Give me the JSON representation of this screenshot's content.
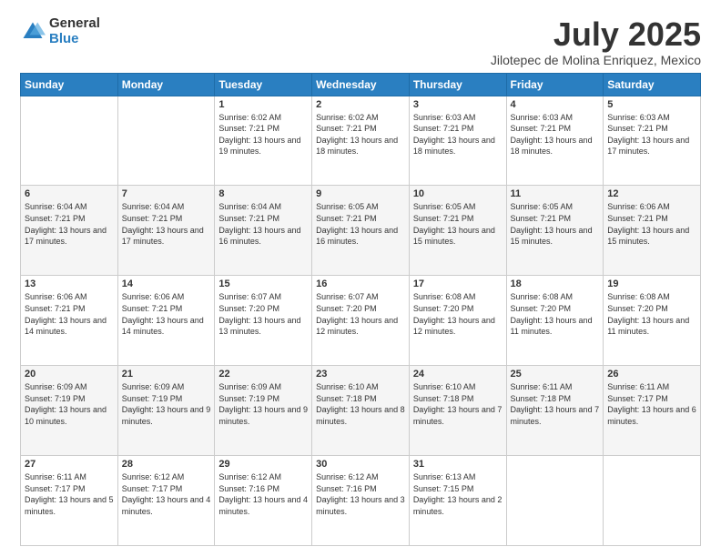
{
  "logo": {
    "general": "General",
    "blue": "Blue"
  },
  "title": {
    "month": "July 2025",
    "location": "Jilotepec de Molina Enriquez, Mexico"
  },
  "weekdays": [
    "Sunday",
    "Monday",
    "Tuesday",
    "Wednesday",
    "Thursday",
    "Friday",
    "Saturday"
  ],
  "weeks": [
    [
      {
        "day": "",
        "sunrise": "",
        "sunset": "",
        "daylight": ""
      },
      {
        "day": "",
        "sunrise": "",
        "sunset": "",
        "daylight": ""
      },
      {
        "day": "1",
        "sunrise": "Sunrise: 6:02 AM",
        "sunset": "Sunset: 7:21 PM",
        "daylight": "Daylight: 13 hours and 19 minutes."
      },
      {
        "day": "2",
        "sunrise": "Sunrise: 6:02 AM",
        "sunset": "Sunset: 7:21 PM",
        "daylight": "Daylight: 13 hours and 18 minutes."
      },
      {
        "day": "3",
        "sunrise": "Sunrise: 6:03 AM",
        "sunset": "Sunset: 7:21 PM",
        "daylight": "Daylight: 13 hours and 18 minutes."
      },
      {
        "day": "4",
        "sunrise": "Sunrise: 6:03 AM",
        "sunset": "Sunset: 7:21 PM",
        "daylight": "Daylight: 13 hours and 18 minutes."
      },
      {
        "day": "5",
        "sunrise": "Sunrise: 6:03 AM",
        "sunset": "Sunset: 7:21 PM",
        "daylight": "Daylight: 13 hours and 17 minutes."
      }
    ],
    [
      {
        "day": "6",
        "sunrise": "Sunrise: 6:04 AM",
        "sunset": "Sunset: 7:21 PM",
        "daylight": "Daylight: 13 hours and 17 minutes."
      },
      {
        "day": "7",
        "sunrise": "Sunrise: 6:04 AM",
        "sunset": "Sunset: 7:21 PM",
        "daylight": "Daylight: 13 hours and 17 minutes."
      },
      {
        "day": "8",
        "sunrise": "Sunrise: 6:04 AM",
        "sunset": "Sunset: 7:21 PM",
        "daylight": "Daylight: 13 hours and 16 minutes."
      },
      {
        "day": "9",
        "sunrise": "Sunrise: 6:05 AM",
        "sunset": "Sunset: 7:21 PM",
        "daylight": "Daylight: 13 hours and 16 minutes."
      },
      {
        "day": "10",
        "sunrise": "Sunrise: 6:05 AM",
        "sunset": "Sunset: 7:21 PM",
        "daylight": "Daylight: 13 hours and 15 minutes."
      },
      {
        "day": "11",
        "sunrise": "Sunrise: 6:05 AM",
        "sunset": "Sunset: 7:21 PM",
        "daylight": "Daylight: 13 hours and 15 minutes."
      },
      {
        "day": "12",
        "sunrise": "Sunrise: 6:06 AM",
        "sunset": "Sunset: 7:21 PM",
        "daylight": "Daylight: 13 hours and 15 minutes."
      }
    ],
    [
      {
        "day": "13",
        "sunrise": "Sunrise: 6:06 AM",
        "sunset": "Sunset: 7:21 PM",
        "daylight": "Daylight: 13 hours and 14 minutes."
      },
      {
        "day": "14",
        "sunrise": "Sunrise: 6:06 AM",
        "sunset": "Sunset: 7:21 PM",
        "daylight": "Daylight: 13 hours and 14 minutes."
      },
      {
        "day": "15",
        "sunrise": "Sunrise: 6:07 AM",
        "sunset": "Sunset: 7:20 PM",
        "daylight": "Daylight: 13 hours and 13 minutes."
      },
      {
        "day": "16",
        "sunrise": "Sunrise: 6:07 AM",
        "sunset": "Sunset: 7:20 PM",
        "daylight": "Daylight: 13 hours and 12 minutes."
      },
      {
        "day": "17",
        "sunrise": "Sunrise: 6:08 AM",
        "sunset": "Sunset: 7:20 PM",
        "daylight": "Daylight: 13 hours and 12 minutes."
      },
      {
        "day": "18",
        "sunrise": "Sunrise: 6:08 AM",
        "sunset": "Sunset: 7:20 PM",
        "daylight": "Daylight: 13 hours and 11 minutes."
      },
      {
        "day": "19",
        "sunrise": "Sunrise: 6:08 AM",
        "sunset": "Sunset: 7:20 PM",
        "daylight": "Daylight: 13 hours and 11 minutes."
      }
    ],
    [
      {
        "day": "20",
        "sunrise": "Sunrise: 6:09 AM",
        "sunset": "Sunset: 7:19 PM",
        "daylight": "Daylight: 13 hours and 10 minutes."
      },
      {
        "day": "21",
        "sunrise": "Sunrise: 6:09 AM",
        "sunset": "Sunset: 7:19 PM",
        "daylight": "Daylight: 13 hours and 9 minutes."
      },
      {
        "day": "22",
        "sunrise": "Sunrise: 6:09 AM",
        "sunset": "Sunset: 7:19 PM",
        "daylight": "Daylight: 13 hours and 9 minutes."
      },
      {
        "day": "23",
        "sunrise": "Sunrise: 6:10 AM",
        "sunset": "Sunset: 7:18 PM",
        "daylight": "Daylight: 13 hours and 8 minutes."
      },
      {
        "day": "24",
        "sunrise": "Sunrise: 6:10 AM",
        "sunset": "Sunset: 7:18 PM",
        "daylight": "Daylight: 13 hours and 7 minutes."
      },
      {
        "day": "25",
        "sunrise": "Sunrise: 6:11 AM",
        "sunset": "Sunset: 7:18 PM",
        "daylight": "Daylight: 13 hours and 7 minutes."
      },
      {
        "day": "26",
        "sunrise": "Sunrise: 6:11 AM",
        "sunset": "Sunset: 7:17 PM",
        "daylight": "Daylight: 13 hours and 6 minutes."
      }
    ],
    [
      {
        "day": "27",
        "sunrise": "Sunrise: 6:11 AM",
        "sunset": "Sunset: 7:17 PM",
        "daylight": "Daylight: 13 hours and 5 minutes."
      },
      {
        "day": "28",
        "sunrise": "Sunrise: 6:12 AM",
        "sunset": "Sunset: 7:17 PM",
        "daylight": "Daylight: 13 hours and 4 minutes."
      },
      {
        "day": "29",
        "sunrise": "Sunrise: 6:12 AM",
        "sunset": "Sunset: 7:16 PM",
        "daylight": "Daylight: 13 hours and 4 minutes."
      },
      {
        "day": "30",
        "sunrise": "Sunrise: 6:12 AM",
        "sunset": "Sunset: 7:16 PM",
        "daylight": "Daylight: 13 hours and 3 minutes."
      },
      {
        "day": "31",
        "sunrise": "Sunrise: 6:13 AM",
        "sunset": "Sunset: 7:15 PM",
        "daylight": "Daylight: 13 hours and 2 minutes."
      },
      {
        "day": "",
        "sunrise": "",
        "sunset": "",
        "daylight": ""
      },
      {
        "day": "",
        "sunrise": "",
        "sunset": "",
        "daylight": ""
      }
    ]
  ]
}
